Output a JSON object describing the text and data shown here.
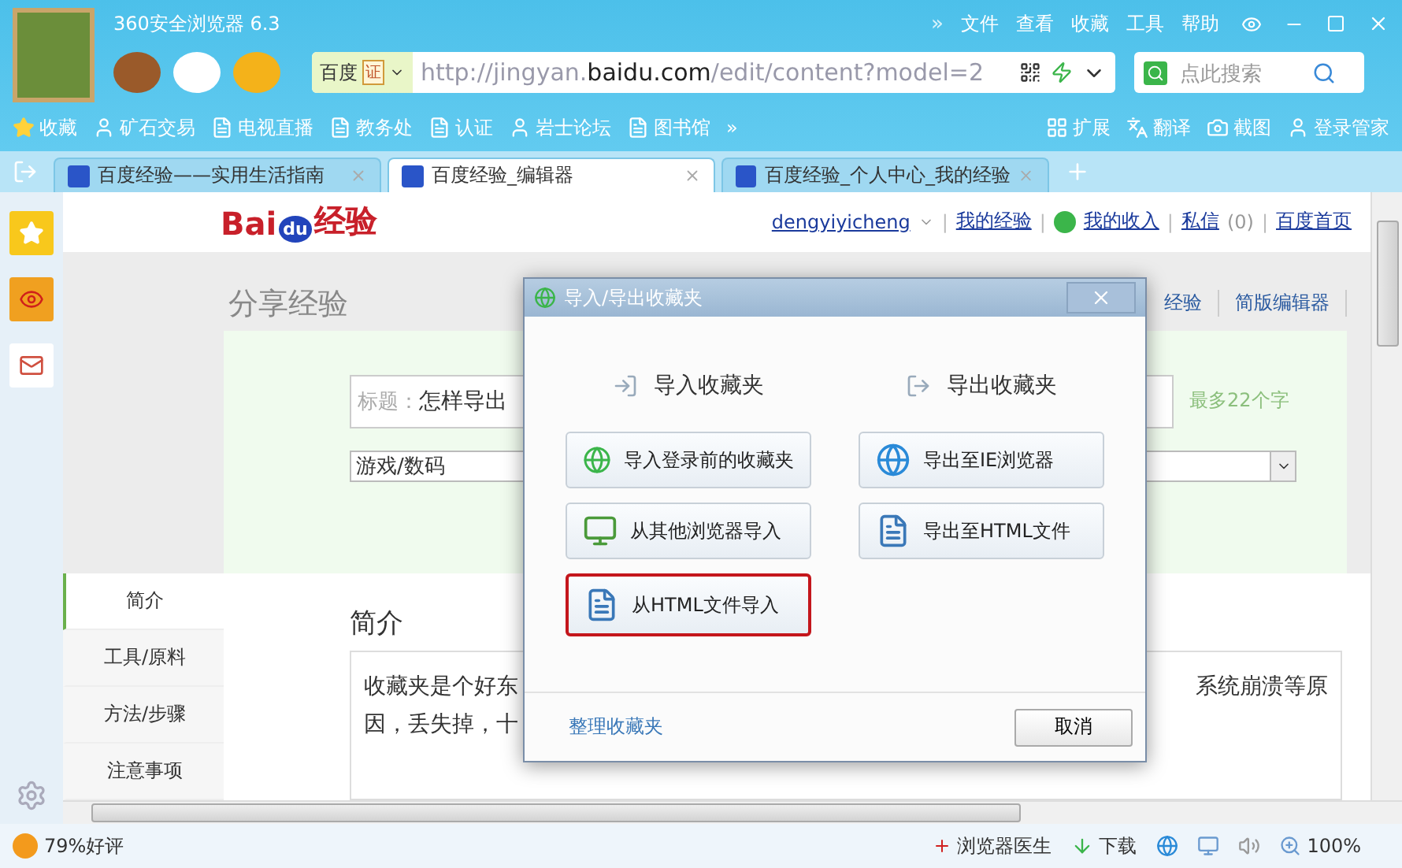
{
  "window": {
    "title": "360安全浏览器 6.3",
    "more": "»",
    "menu": [
      "文件",
      "查看",
      "收藏",
      "工具",
      "帮助"
    ]
  },
  "address_bar": {
    "site_name": "百度",
    "cert_badge": "证",
    "url_prefix": "http://jingyan.",
    "url_domain": "baidu.com",
    "url_path": "/edit/content?model=2"
  },
  "search": {
    "placeholder": "点此搜索"
  },
  "bookmarks": [
    {
      "label": "收藏",
      "kind": "favorites"
    },
    {
      "label": "矿石交易",
      "kind": "site"
    },
    {
      "label": "电视直播",
      "kind": "page"
    },
    {
      "label": "教务处",
      "kind": "page"
    },
    {
      "label": "认证",
      "kind": "page"
    },
    {
      "label": "岩士论坛",
      "kind": "site"
    },
    {
      "label": "图书馆",
      "kind": "page"
    }
  ],
  "bookmarks_more": "»",
  "tools": [
    {
      "label": "扩展",
      "kind": "apps"
    },
    {
      "label": "翻译",
      "kind": "translate"
    },
    {
      "label": "截图",
      "kind": "screenshot"
    },
    {
      "label": "登录管家",
      "kind": "login"
    }
  ],
  "tabs": [
    {
      "label": "百度经验——实用生活指南",
      "selected": false
    },
    {
      "label": "百度经验_编辑器",
      "selected": true
    },
    {
      "label": "百度经验_个人中心_我的经验",
      "selected": false
    }
  ],
  "page": {
    "logo": {
      "left": "Bai",
      "paw": "du",
      "right": "经验"
    },
    "user": {
      "name": "dengyiyicheng",
      "links": [
        "我的经验",
        "我的收入",
        "私信",
        "百度首页"
      ],
      "message_count": "(0)",
      "separator": "|"
    },
    "heading": "分享经验",
    "nav": [
      "经验",
      "简版编辑器"
    ],
    "title_field": {
      "label": "标题：",
      "value": "怎样导出"
    },
    "title_hint": "最多22个字",
    "category": "游戏/数码",
    "sections": [
      {
        "label": "简介",
        "selected": true
      },
      {
        "label": "工具/原料",
        "selected": false
      },
      {
        "label": "方法/步骤",
        "selected": false
      },
      {
        "label": "注意事项",
        "selected": false
      }
    ],
    "section_heading": "简介",
    "intro_left": [
      "收藏夹是个好东",
      "因，丢失掉，十"
    ],
    "intro_right": [
      "系统崩溃等原"
    ]
  },
  "dialog": {
    "title": "导入/导出收藏夹",
    "import_heading": "导入收藏夹",
    "export_heading": "导出收藏夹",
    "import_buttons": [
      {
        "label": "导入登录前的收藏夹",
        "kind": "cloud",
        "highlighted": false
      },
      {
        "label": "从其他浏览器导入",
        "kind": "browser",
        "highlighted": false
      },
      {
        "label": "从HTML文件导入",
        "kind": "html",
        "highlighted": true
      }
    ],
    "export_buttons": [
      {
        "label": "导出至IE浏览器",
        "kind": "ie",
        "highlighted": false
      },
      {
        "label": "导出至HTML文件",
        "kind": "html",
        "highlighted": false
      }
    ],
    "manage_link": "整理收藏夹",
    "cancel": "取消"
  },
  "status_bar": {
    "rating": "79%好评",
    "doctor": "浏览器医生",
    "download": "下载",
    "zoom": "100%"
  }
}
